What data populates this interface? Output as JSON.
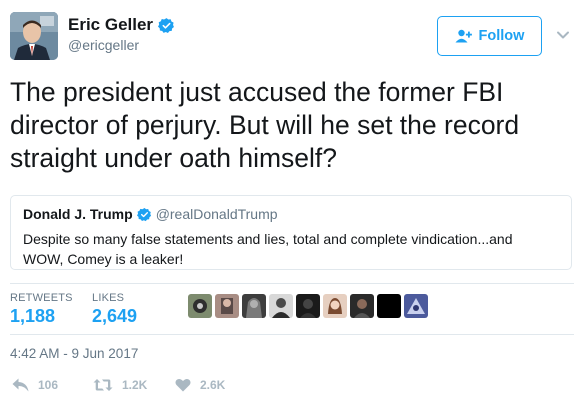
{
  "author": {
    "display_name": "Eric Geller",
    "handle": "@ericgeller",
    "avatar_icon": "person-photo"
  },
  "follow_button": {
    "label": "Follow",
    "icon": "add-person-icon"
  },
  "tweet": {
    "text": "The president just accused the former FBI director of perjury. But will he set the record straight under oath himself?"
  },
  "quoted_tweet": {
    "display_name": "Donald J. Trump",
    "handle": "@realDonaldTrump",
    "text": "Despite so many false statements and lies, total and complete vindication...and WOW, Comey is a leaker!"
  },
  "stats": {
    "retweets_label": "RETWEETS",
    "retweets_value": "1,188",
    "likes_label": "LIKES",
    "likes_value": "2,649"
  },
  "likers": [
    "liker-avatar-1",
    "liker-avatar-2",
    "liker-avatar-3",
    "liker-avatar-4",
    "liker-avatar-5",
    "liker-avatar-6",
    "liker-avatar-7",
    "liker-avatar-8",
    "liker-avatar-9"
  ],
  "timestamp": "4:42 AM - 9 Jun 2017",
  "actions": {
    "replies": "106",
    "retweets": "1.2K",
    "likes": "2.6K"
  },
  "colors": {
    "accent": "#1da1f2",
    "muted": "#657786",
    "icon_muted": "#aab8c2",
    "border": "#e1e8ed"
  }
}
